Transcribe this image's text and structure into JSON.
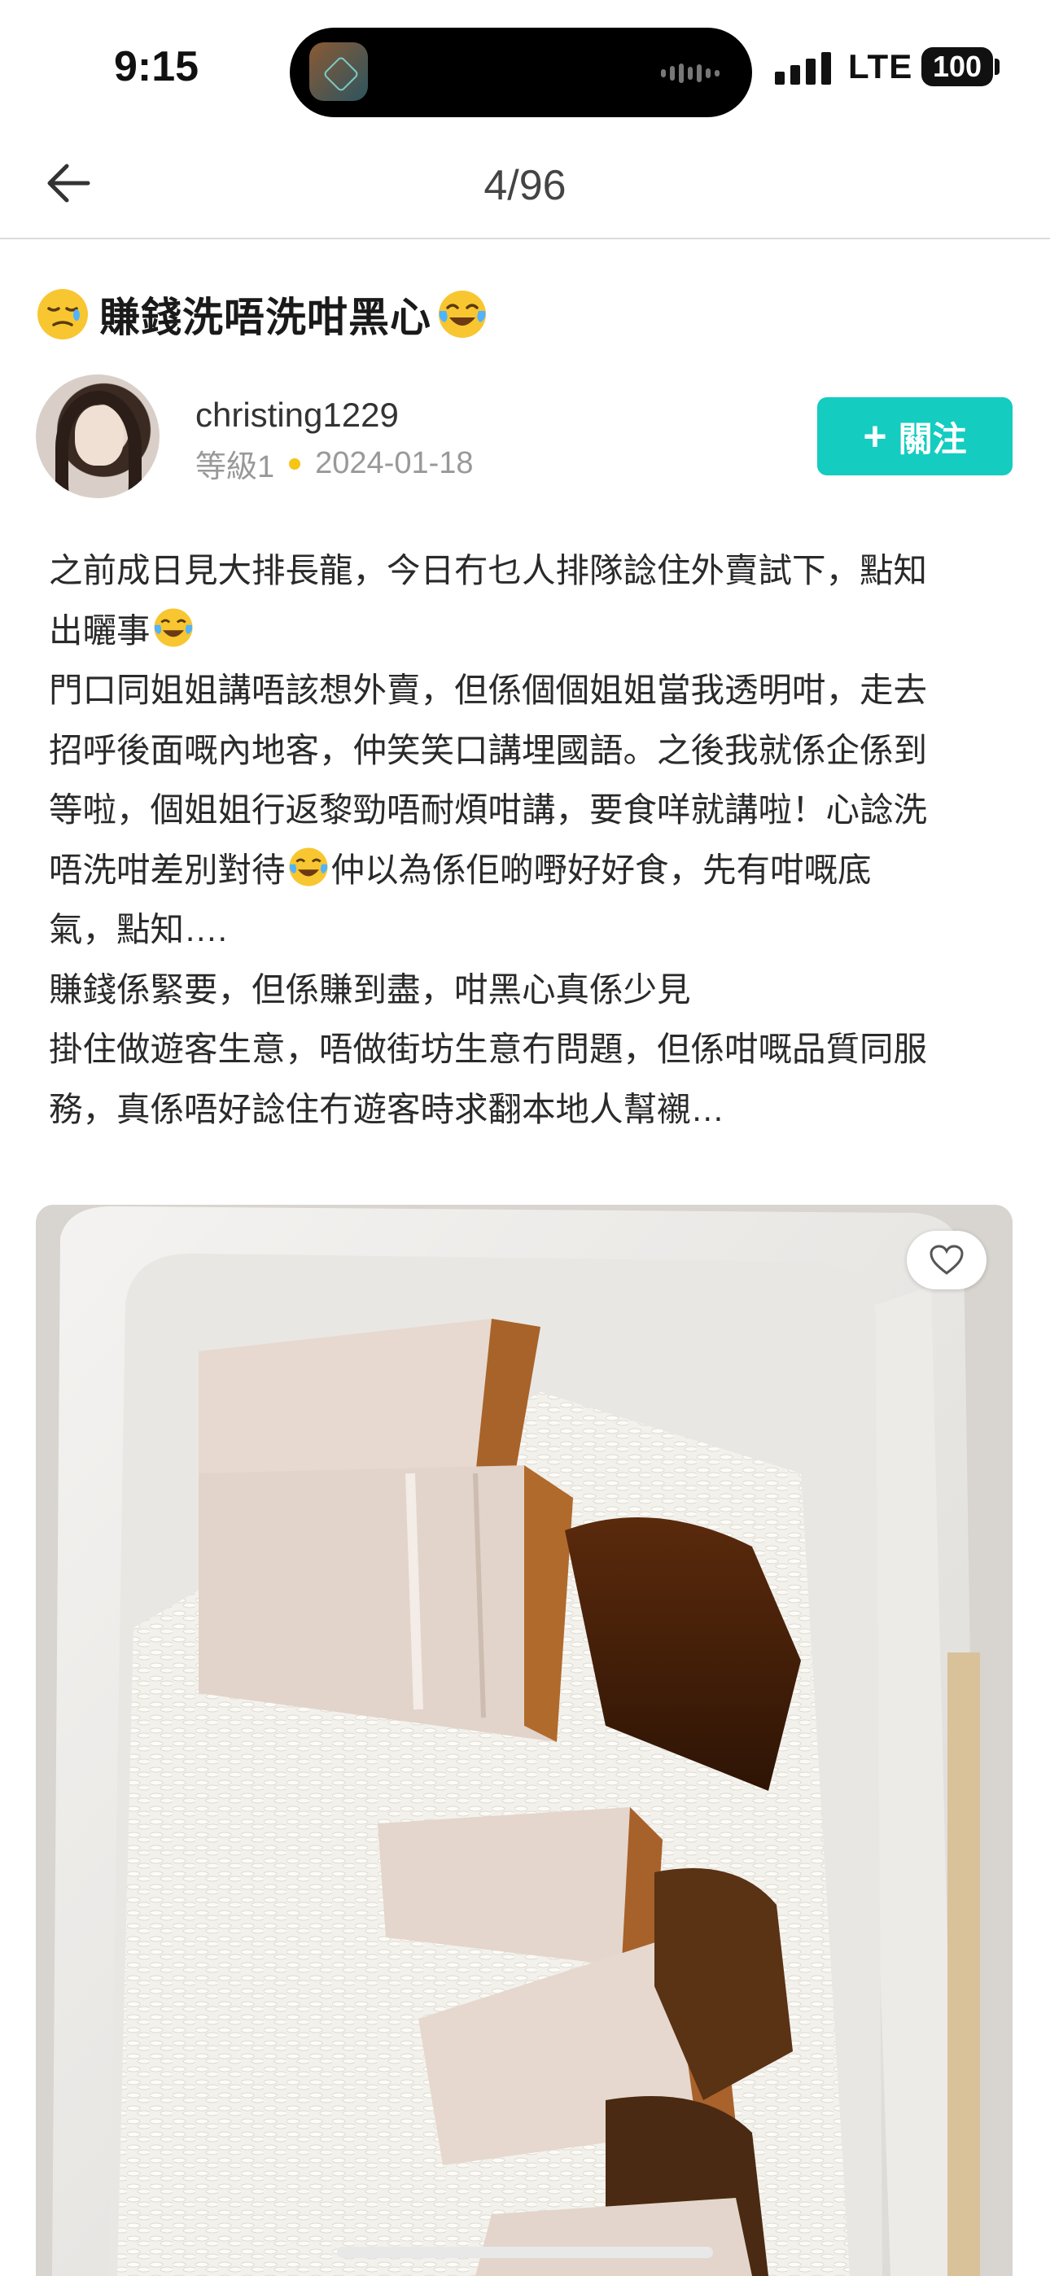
{
  "status_bar": {
    "time": "9:15",
    "network": "LTE",
    "battery": "100"
  },
  "header": {
    "page_counter": "4/96"
  },
  "post": {
    "title": "賺錢洗唔洗咁黑心",
    "author": {
      "username": "christing1229",
      "level": "等級1",
      "date": "2024-01-18",
      "follow_label": "關注"
    },
    "body_lines": [
      "之前成日見大排長龍，今日冇乜人排隊諗住外賣試下，點知",
      "出曬事",
      "門口同姐姐講唔該想外賣，但係個個姐姐當我透明咁，走去",
      "招呼後面嘅內地客，仲笑笑口講埋國語。之後我就係企係到",
      "等啦，個姐姐行返黎勁唔耐煩咁講，要食咩就講啦！心諗洗",
      "唔洗咁差別對待",
      "仲以為係佢啲嘢好好食，先有咁嘅底",
      "氣，點知….",
      "賺錢係緊要，但係賺到盡，咁黑心真係少見",
      "掛住做遊客生意，唔做街坊生意冇問題，但係咁嘅品質同服",
      "務，真係唔好諗住冇遊客時求翻本地人幫襯…"
    ]
  },
  "icons": {
    "back": "arrow-left-icon",
    "like": "heart-outline-icon",
    "title_emoji_left": "sad-face-emoji",
    "title_emoji_right": "tears-of-joy-emoji"
  },
  "colors": {
    "accent": "#14ccc0",
    "level_dot": "#f5c518"
  }
}
